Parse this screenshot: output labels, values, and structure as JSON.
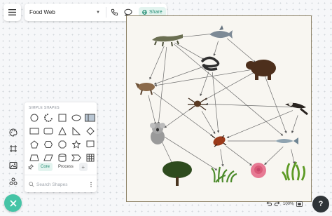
{
  "header": {
    "menu_icon": "hamburger-icon",
    "document_title": "Food Web",
    "title_caret": "▼",
    "share_label": "Share",
    "colors": {
      "accent": "#1d8a6f",
      "share_bg": "#e3f4ef"
    }
  },
  "left_rail": {
    "icons": [
      "palette-icon",
      "frame-icon",
      "image-icon",
      "shapes-icon"
    ],
    "fab_icon": "close-icon",
    "fab_color": "#45c4a6"
  },
  "shape_panel": {
    "heading": "SIMPLE SHAPES",
    "shapes": [
      "circle-shape",
      "circular-arrow-shape",
      "square-shape",
      "ellipse-shape",
      "card-shape",
      "rectangle-shape",
      "rounded-rectangle-shape",
      "triangle-shape",
      "right-triangle-shape",
      "diamond-shape",
      "pentagon-shape",
      "hexagon-shape",
      "octagon-shape",
      "star-shape",
      "document-shape",
      "trapezoid-shape",
      "parallelogram-shape",
      "cylinder-shape",
      "step-shape",
      "table-shape"
    ],
    "tabs": [
      "Core",
      "Process"
    ],
    "add_tab": "+",
    "search_placeholder": "Search Shapes"
  },
  "diagram": {
    "nodes": [
      {
        "id": "crocodile",
        "icon": "crocodile-icon"
      },
      {
        "id": "shark",
        "icon": "shark-icon"
      },
      {
        "id": "snake",
        "icon": "snake-icon"
      },
      {
        "id": "bear",
        "icon": "bear-icon"
      },
      {
        "id": "wolf",
        "icon": "wolf-icon"
      },
      {
        "id": "spider",
        "icon": "spider-icon"
      },
      {
        "id": "eagle",
        "icon": "eagle-icon"
      },
      {
        "id": "koala",
        "icon": "koala-icon"
      },
      {
        "id": "beetle",
        "icon": "beetle-icon"
      },
      {
        "id": "fish",
        "icon": "fish-icon"
      },
      {
        "id": "tree",
        "icon": "tree-icon"
      },
      {
        "id": "grass",
        "icon": "grass-icon"
      },
      {
        "id": "rose",
        "icon": "rose-icon"
      },
      {
        "id": "seaweed",
        "icon": "seaweed-icon"
      }
    ],
    "edges": [
      [
        "shark",
        "crocodile"
      ],
      [
        "shark",
        "snake"
      ],
      [
        "shark",
        "bear"
      ],
      [
        "crocodile",
        "snake"
      ],
      [
        "crocodile",
        "wolf"
      ],
      [
        "crocodile",
        "koala"
      ],
      [
        "crocodile",
        "fish"
      ],
      [
        "snake",
        "wolf"
      ],
      [
        "snake",
        "spider"
      ],
      [
        "snake",
        "beetle"
      ],
      [
        "bear",
        "wolf"
      ],
      [
        "bear",
        "spider"
      ],
      [
        "bear",
        "fish"
      ],
      [
        "wolf",
        "koala"
      ],
      [
        "wolf",
        "beetle"
      ],
      [
        "spider",
        "koala"
      ],
      [
        "spider",
        "beetle"
      ],
      [
        "eagle",
        "beetle"
      ],
      [
        "eagle",
        "fish"
      ],
      [
        "eagle",
        "spider"
      ],
      [
        "koala",
        "tree"
      ],
      [
        "koala",
        "grass"
      ],
      [
        "beetle",
        "grass"
      ],
      [
        "beetle",
        "rose"
      ],
      [
        "beetle",
        "fish"
      ],
      [
        "fish",
        "seaweed"
      ],
      [
        "fish",
        "rose"
      ]
    ]
  },
  "zoom_bar": {
    "undo_icon": "undo-icon",
    "redo_icon": "redo-icon",
    "zoom_level": "100%",
    "fit_icon": "fit-screen-icon",
    "help_label": "?"
  }
}
